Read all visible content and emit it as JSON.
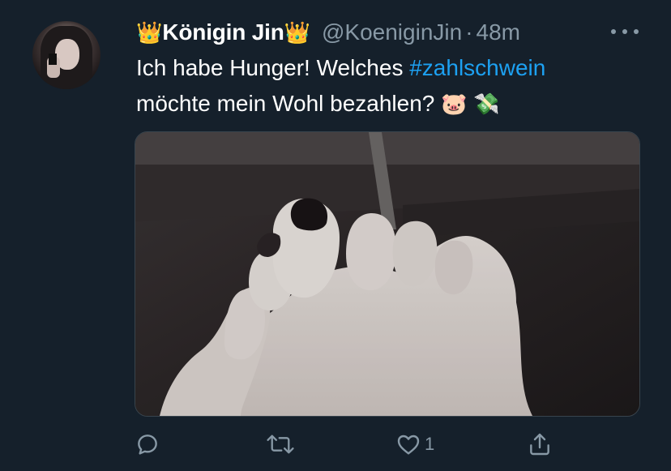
{
  "tweet": {
    "author": {
      "crown_emoji": "👑",
      "display_name": "Königin Jin",
      "handle": "@KoeniginJin",
      "separator": "·",
      "time": "48m"
    },
    "text": {
      "line1": "Ich habe Hunger! Welches ",
      "hashtag": "#zahlschwein",
      "line2": "möchte mein Wohl bezahlen? ",
      "emoji_pig": "🐷",
      "emoji_money": "💸"
    },
    "actions": {
      "reply_icon": "reply-icon",
      "retweet_icon": "retweet-icon",
      "like_icon": "heart-icon",
      "like_count": "1",
      "share_icon": "share-icon"
    },
    "colors": {
      "background": "#15202b",
      "accent": "#1da1f2",
      "secondary_text": "#8899a6"
    }
  }
}
